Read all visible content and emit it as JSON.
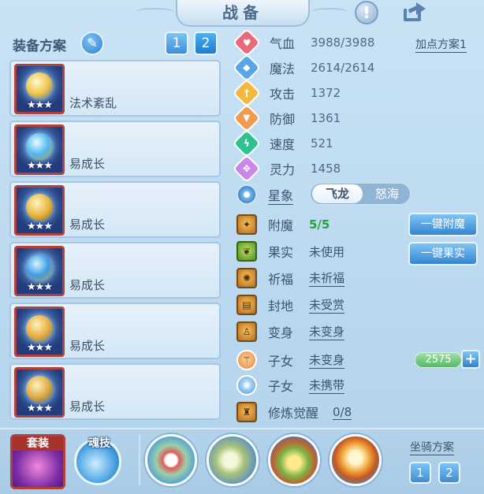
{
  "header": {
    "title": "战备",
    "info_icon": "info-icon",
    "share_icon": "share-icon"
  },
  "equipment": {
    "title": "装备方案",
    "edit_icon": "pencil-icon",
    "plans": [
      "1",
      "2"
    ],
    "active_plan": "2",
    "items": [
      {
        "name": "法术紊乱",
        "stars": "★★★",
        "icon": "weapon-icon"
      },
      {
        "name": "易成长",
        "stars": "★★★",
        "icon": "helmet-icon"
      },
      {
        "name": "易成长",
        "stars": "★★★",
        "icon": "armor-icon"
      },
      {
        "name": "易成长",
        "stars": "★★★",
        "icon": "necklace-icon"
      },
      {
        "name": "易成长",
        "stars": "★★★",
        "icon": "belt-icon"
      },
      {
        "name": "易成长",
        "stars": "★★★",
        "icon": "boots-icon"
      }
    ]
  },
  "attributes": {
    "addpoint_label": "加点方案1",
    "rows": [
      {
        "label": "气血",
        "value": "3988/3988",
        "icon": "heart-icon",
        "color": "#e86a7a"
      },
      {
        "label": "魔法",
        "value": "2614/2614",
        "icon": "mana-icon",
        "color": "#56a6ec"
      },
      {
        "label": "攻击",
        "value": "1372",
        "icon": "sword-icon",
        "color": "#f2b93e"
      },
      {
        "label": "防御",
        "value": "1361",
        "icon": "shield-icon",
        "color": "#f29a4e"
      },
      {
        "label": "速度",
        "value": "521",
        "icon": "speed-icon",
        "color": "#2fc28f"
      },
      {
        "label": "灵力",
        "value": "1458",
        "icon": "spirit-icon",
        "color": "#c987e6"
      }
    ]
  },
  "constellation": {
    "label": "星象",
    "options": [
      "飞龙",
      "怒海"
    ],
    "selected": "飞龙"
  },
  "features": [
    {
      "label": "附魔",
      "value": "5/5",
      "icon": "enchant-icon"
    },
    {
      "label": "果实",
      "value": "未使用",
      "icon": "fruit-icon"
    },
    {
      "label": "祈福",
      "value": "未祈福",
      "icon": "bless-icon"
    },
    {
      "label": "封地",
      "value": "未受赏",
      "icon": "fief-icon"
    },
    {
      "label": "变身",
      "value": "未变身",
      "icon": "transform-icon"
    },
    {
      "label": "子女",
      "value": "未变身",
      "icon": "child-icon"
    },
    {
      "label": "子女",
      "value": "未携带",
      "icon": "paw-icon"
    },
    {
      "label": "修炼觉醒",
      "value": "0/8",
      "icon": "cultivate-icon"
    }
  ],
  "actions": {
    "enchant_all": "一键附魔",
    "fruit_all": "一键果实"
  },
  "child_score": {
    "value": "2575",
    "plus": "+"
  },
  "bottom": {
    "suit_label": "套装",
    "soul_label": "魂技",
    "skill_icons": [
      "skill-slot-1-icon",
      "skill-slot-2-icon",
      "skill-slot-3-icon",
      "skill-slot-4-icon"
    ],
    "mount_title": "坐骑方案",
    "mount_plans": [
      "1",
      "2"
    ]
  }
}
